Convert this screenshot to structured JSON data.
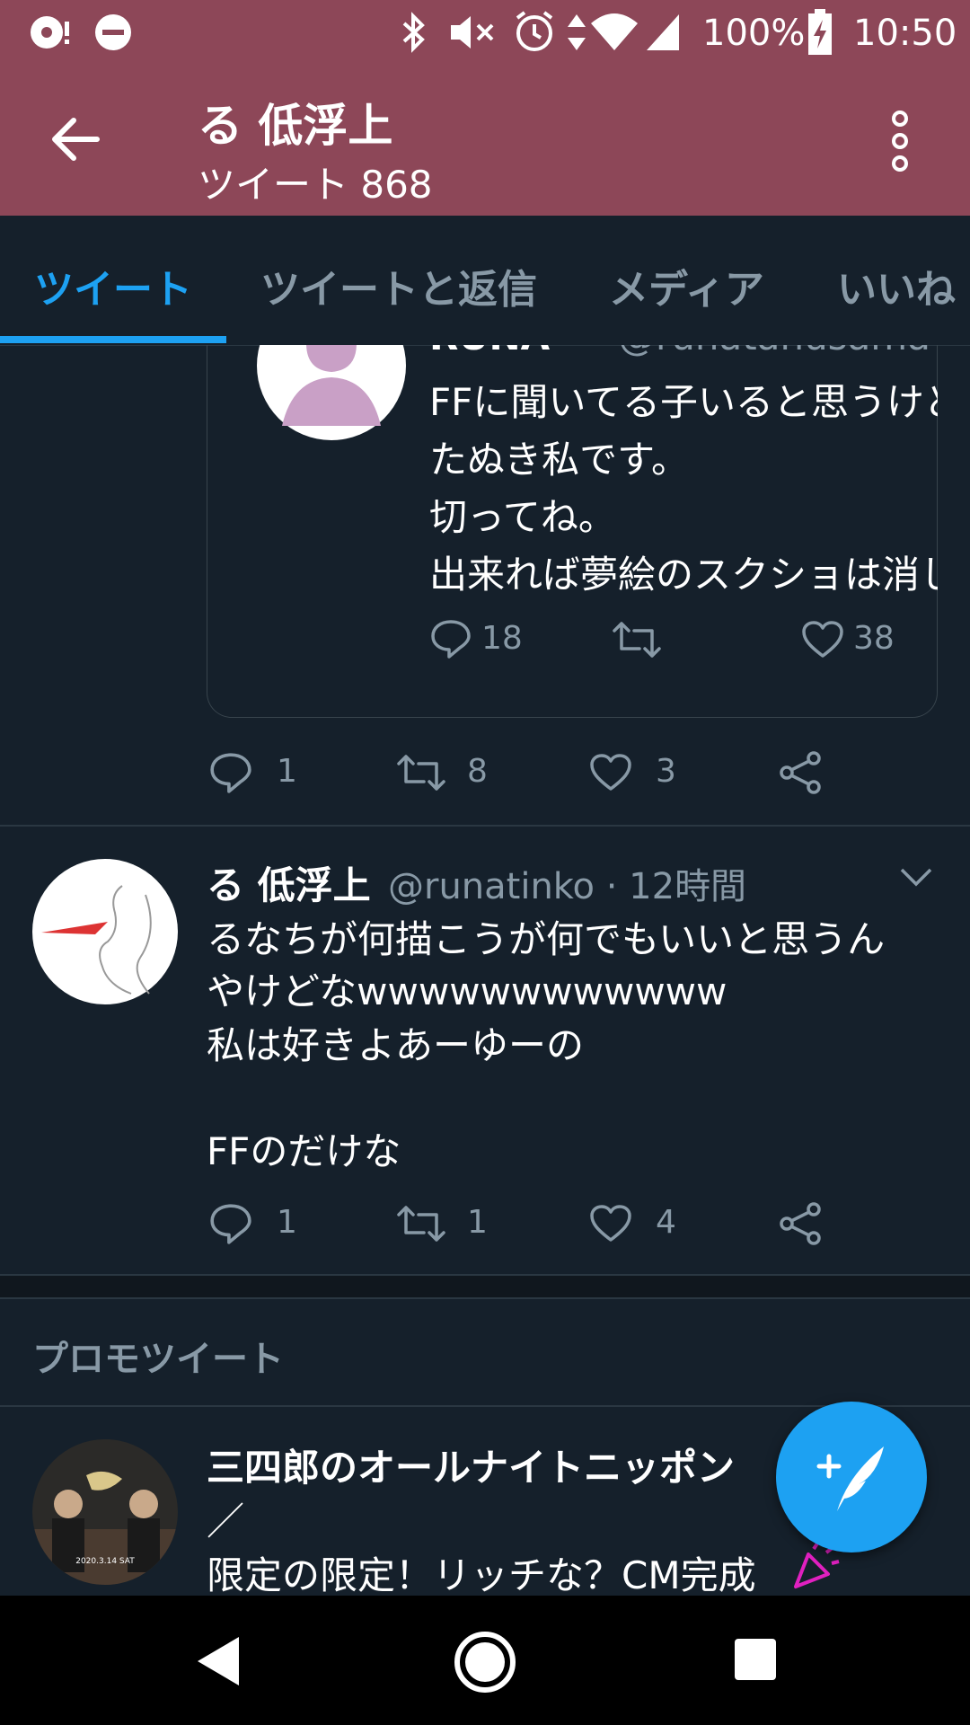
{
  "status_bar": {
    "battery": "100%",
    "time": "10:50"
  },
  "header": {
    "title": "る 低浮上",
    "subtitle": "ツイート 868"
  },
  "tabs": [
    {
      "label": "ツイート",
      "active": true
    },
    {
      "label": "ツイートと返信",
      "active": false
    },
    {
      "label": "メディア",
      "active": false
    },
    {
      "label": "いいね",
      "active": false
    }
  ],
  "quoted_tweet": {
    "name": "RUNA",
    "handle": "@runatanusama",
    "lines": [
      "FFに聞いてる子いると思うけど",
      "たぬき私です。",
      "切ってね。",
      "出来れば夢絵のスクショは消して"
    ],
    "replies": "18",
    "likes": "38"
  },
  "tweet1_actions": {
    "replies": "1",
    "retweets": "8",
    "likes": "3"
  },
  "tweet2": {
    "name": "る 低浮上",
    "handle_time": "@runatinko · 12時間",
    "lines": [
      "るなちが何描こうが何でもいいと思うん",
      "やけどなwwwwwwwwwwww",
      "私は好きよあーゆーの",
      "",
      "FFのだけな"
    ],
    "replies": "1",
    "retweets": "1",
    "likes": "4"
  },
  "promo": {
    "label": "プロモツイート",
    "name": "三四郎のオールナイトニッポン",
    "line1": "／",
    "line2": "限定の限定！リッチな？CM完成",
    "avatar_text": "2020.3.14 SAT"
  },
  "colors": {
    "header_bg": "#8d4758",
    "body_bg": "#15202b",
    "accent": "#1da1f2",
    "muted": "#8899a6"
  }
}
